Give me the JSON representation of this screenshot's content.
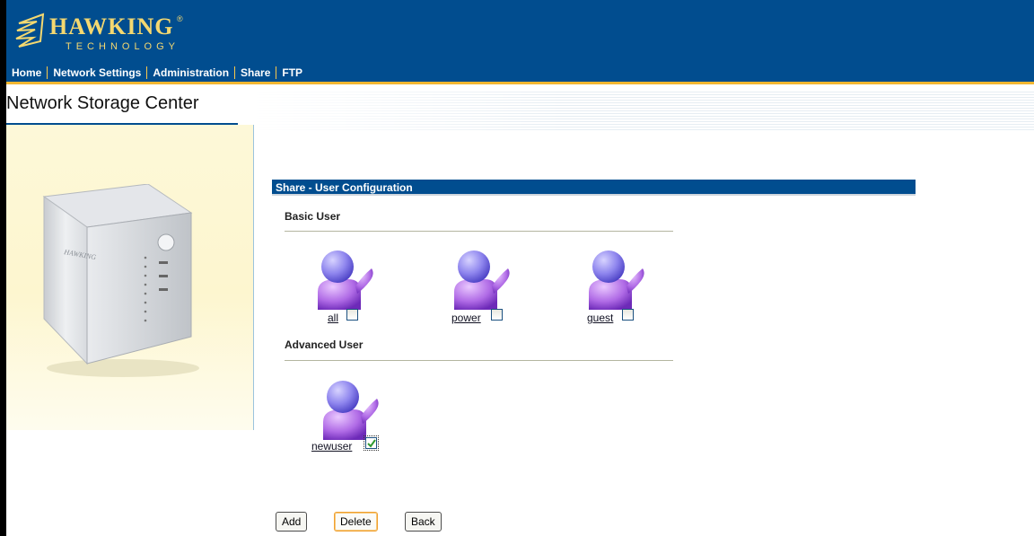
{
  "header": {
    "logo_name": "HAWKING",
    "logo_reg": "®",
    "logo_sub": "TECHNOLOGY",
    "brand_color": "#014d8f",
    "accent_color": "#f2b631"
  },
  "nav": {
    "items": [
      {
        "label": "Home"
      },
      {
        "label": "Network Settings"
      },
      {
        "label": "Administration"
      },
      {
        "label": "Share"
      },
      {
        "label": "FTP"
      }
    ]
  },
  "sidebar": {
    "title": "Network Storage Center",
    "device_brand": "HAWKING"
  },
  "main": {
    "section_title": "Share - User Configuration",
    "basic_label": "Basic User",
    "advanced_label": "Advanced User",
    "basic_users": [
      {
        "name": "all",
        "checked": false
      },
      {
        "name": "power",
        "checked": false
      },
      {
        "name": "guest",
        "checked": false
      }
    ],
    "advanced_users": [
      {
        "name": "newuser",
        "checked": true
      }
    ],
    "icons": {
      "user": "user-icon",
      "checkbox": "checkbox-icon"
    }
  },
  "buttons": {
    "add": "Add",
    "delete": "Delete",
    "back": "Back"
  }
}
